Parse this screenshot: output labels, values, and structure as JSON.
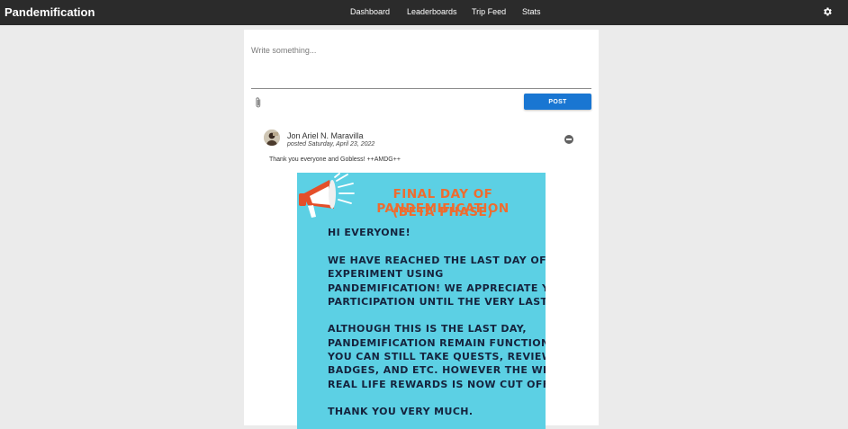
{
  "app": {
    "brand": "Pandemification",
    "nav": [
      "Dashboard",
      "Leaderboards",
      "Trip Feed",
      "Stats"
    ]
  },
  "composer": {
    "placeholder": "Write something...",
    "post_label": "POST"
  },
  "post": {
    "author": "Jon Ariel N. Maravilla",
    "posted": "posted Saturday, April 23, 2022",
    "text": "Thank you everyone and Gobless! ++AMDG++",
    "poster": {
      "title_1": "FINAL DAY OF PANDEMIFICATION",
      "title_2": "(BETA PHASE)",
      "lines": [
        "HI EVERYONE!",
        "WE HAVE REACHED THE LAST DAY OF THE",
        "EXPERIMENT USING",
        "PANDEMIFICATION! WE APPRECIATE YOUR",
        "PARTICIPATION UNTIL THE VERY LAST.",
        "ALTHOUGH THIS IS THE LAST DAY,",
        "PANDEMIFICATION REMAIN FUNCTIONAL AND",
        "YOU CAN STILL TAKE QUESTS, REVIEW, EARN",
        "BADGES,  AND ETC. HOWEVER THE WEEKLY IN",
        "REAL LIFE REWARDS IS NOW CUT OFF.",
        "THANK YOU VERY MUCH."
      ]
    }
  },
  "colors": {
    "topbar": "#2b2b2b",
    "accent": "#1976d2",
    "poster_bg": "#5cd0e4",
    "poster_title": "#ee6c2f",
    "poster_text": "#15233d"
  },
  "icons": [
    "settings-gear-icon",
    "attachment-paperclip-icon",
    "remove-circle-icon",
    "megaphone-icon"
  ]
}
